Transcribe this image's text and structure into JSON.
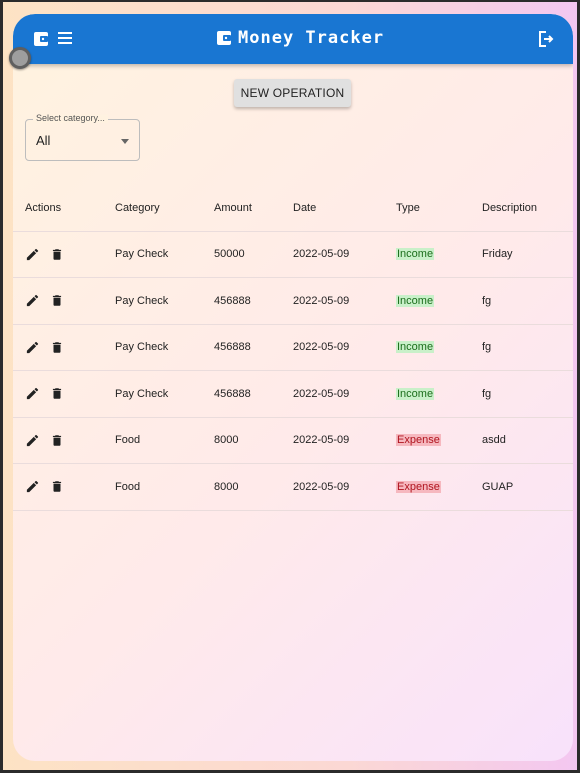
{
  "app": {
    "title": "Money Tracker"
  },
  "header": {
    "icons": {
      "left": "wallet-icon",
      "menu": "menu-icon",
      "title": "wallet-icon",
      "right": "logout-icon"
    },
    "color": "#1976d2"
  },
  "toolbar": {
    "new_operation_label": "NEW OPERATION"
  },
  "filter": {
    "label": "Select category...",
    "value": "All"
  },
  "table": {
    "columns": [
      "Actions",
      "Category",
      "Amount",
      "Date",
      "Type",
      "Description"
    ],
    "rows": [
      {
        "category": "Pay Check",
        "amount": "50000",
        "date": "2022-05-09",
        "type": "Income",
        "description": "Friday"
      },
      {
        "category": "Pay Check",
        "amount": "456888",
        "date": "2022-05-09",
        "type": "Income",
        "description": "fg"
      },
      {
        "category": "Pay Check",
        "amount": "456888",
        "date": "2022-05-09",
        "type": "Income",
        "description": "fg"
      },
      {
        "category": "Pay Check",
        "amount": "456888",
        "date": "2022-05-09",
        "type": "Income",
        "description": "fg"
      },
      {
        "category": "Food",
        "amount": "8000",
        "date": "2022-05-09",
        "type": "Expense",
        "description": "asdd"
      },
      {
        "category": "Food",
        "amount": "8000",
        "date": "2022-05-09",
        "type": "Expense",
        "description": "GUAP"
      }
    ],
    "row_icons": {
      "edit": "pencil-icon",
      "delete": "trash-icon"
    },
    "type_colors": {
      "Income": "#c9f0c9",
      "Expense": "#f6b8bf"
    }
  }
}
